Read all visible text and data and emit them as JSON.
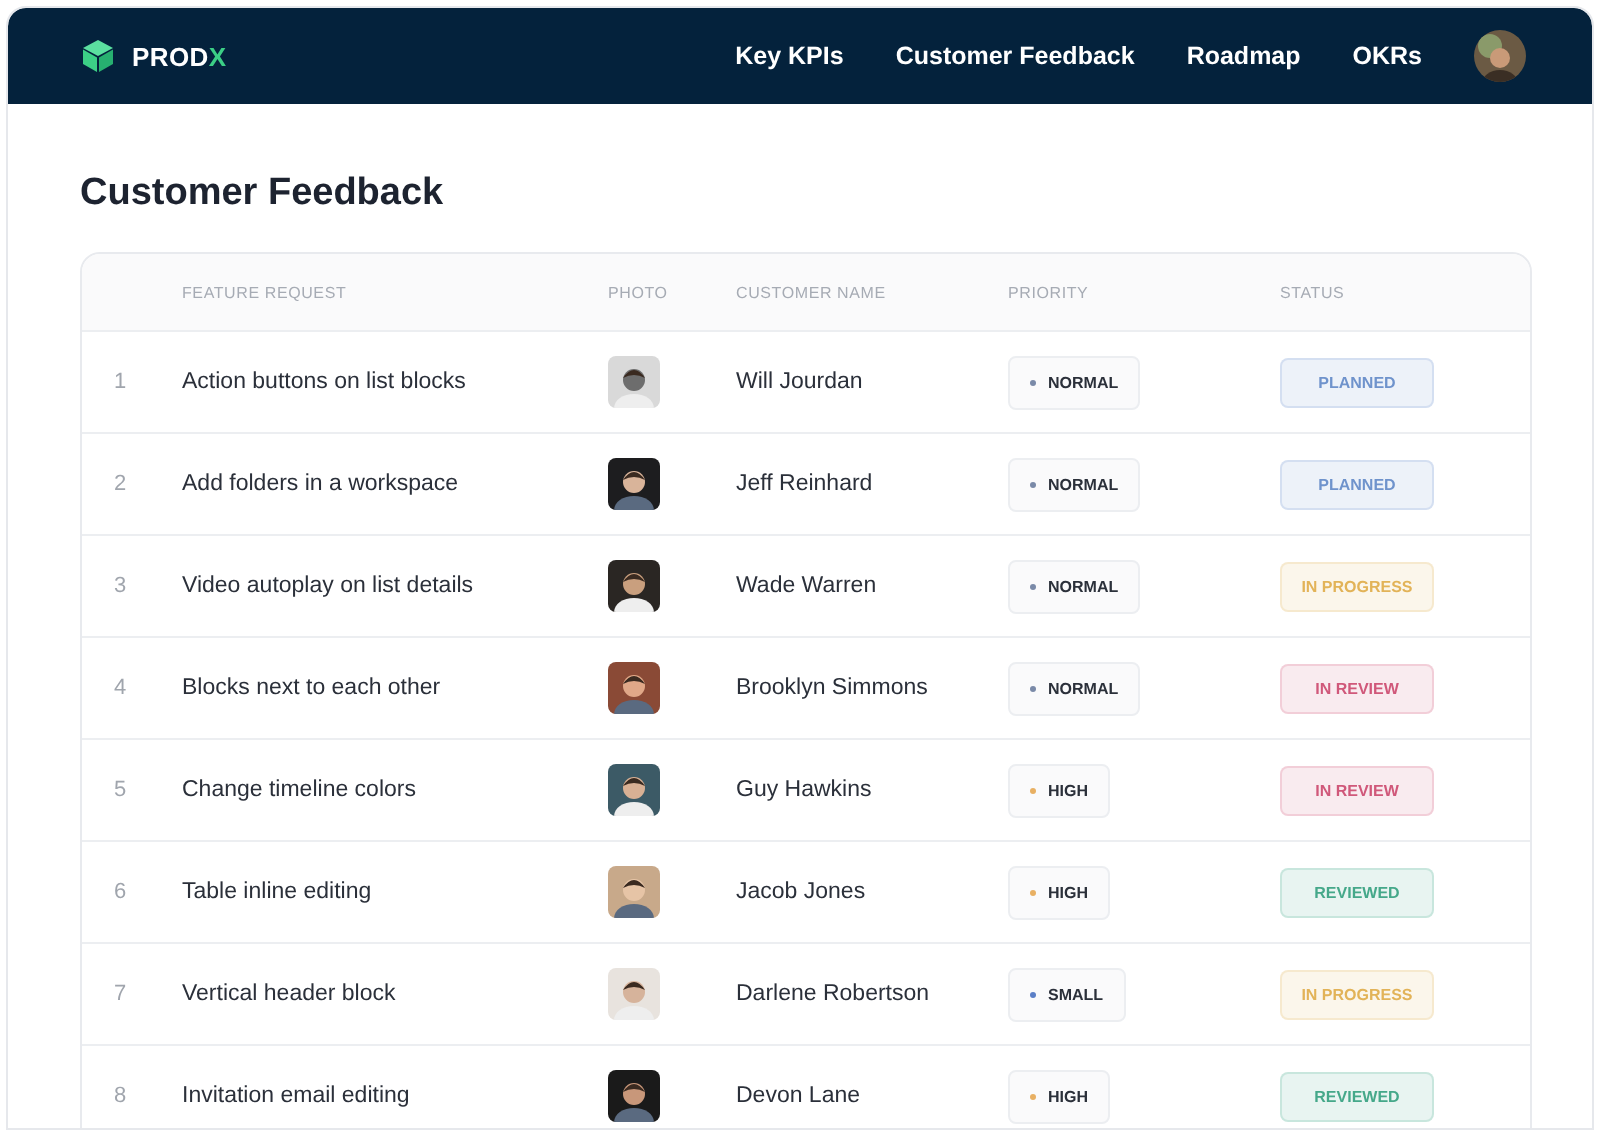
{
  "header": {
    "logo": "PROD",
    "logo_accent": "X",
    "nav": [
      "Key KPIs",
      "Customer Feedback",
      "Roadmap",
      "OKRs"
    ]
  },
  "page_title": "Customer Feedback",
  "table": {
    "columns": [
      "FEATURE REQUEST",
      "PHOTO",
      "CUSTOMER NAME",
      "PRIORITY",
      "STATUS"
    ],
    "rows": [
      {
        "number": "1",
        "feature": "Action buttons on list blocks",
        "customer": "Will Jourdan",
        "priority": {
          "label": "NORMAL",
          "color": "#7a8aa8"
        },
        "status": {
          "label": "PLANNED",
          "color": "#6f93cc"
        }
      },
      {
        "number": "2",
        "feature": "Add folders in a workspace",
        "customer": "Jeff Reinhard",
        "priority": {
          "label": "NORMAL",
          "color": "#7a8aa8"
        },
        "status": {
          "label": "PLANNED",
          "color": "#6f93cc"
        }
      },
      {
        "number": "3",
        "feature": "Video autoplay on list details",
        "customer": "Wade Warren",
        "priority": {
          "label": "NORMAL",
          "color": "#7a8aa8"
        },
        "status": {
          "label": "IN PROGRESS",
          "color": "#e2b358"
        }
      },
      {
        "number": "4",
        "feature": "Blocks next to each other",
        "customer": "Brooklyn Simmons",
        "priority": {
          "label": "NORMAL",
          "color": "#7a8aa8"
        },
        "status": {
          "label": "IN REVIEW",
          "color": "#d0587a"
        }
      },
      {
        "number": "5",
        "feature": "Change timeline colors",
        "customer": "Guy Hawkins",
        "priority": {
          "label": "HIGH",
          "color": "#e8b063"
        },
        "status": {
          "label": "IN REVIEW",
          "color": "#d0587a"
        }
      },
      {
        "number": "6",
        "feature": "Table inline editing",
        "customer": "Jacob Jones",
        "priority": {
          "label": "HIGH",
          "color": "#e8b063"
        },
        "status": {
          "label": "REVIEWED",
          "color": "#45a88a"
        }
      },
      {
        "number": "7",
        "feature": "Vertical header block",
        "customer": "Darlene Robertson",
        "priority": {
          "label": "SMALL",
          "color": "#5b7fc7"
        },
        "status": {
          "label": "IN PROGRESS",
          "color": "#e2b358"
        }
      },
      {
        "number": "8",
        "feature": "Invitation email editing",
        "customer": "Devon Lane",
        "priority": {
          "label": "HIGH",
          "color": "#e8b063"
        },
        "status": {
          "label": "REVIEWED",
          "color": "#45a88a"
        }
      }
    ]
  }
}
